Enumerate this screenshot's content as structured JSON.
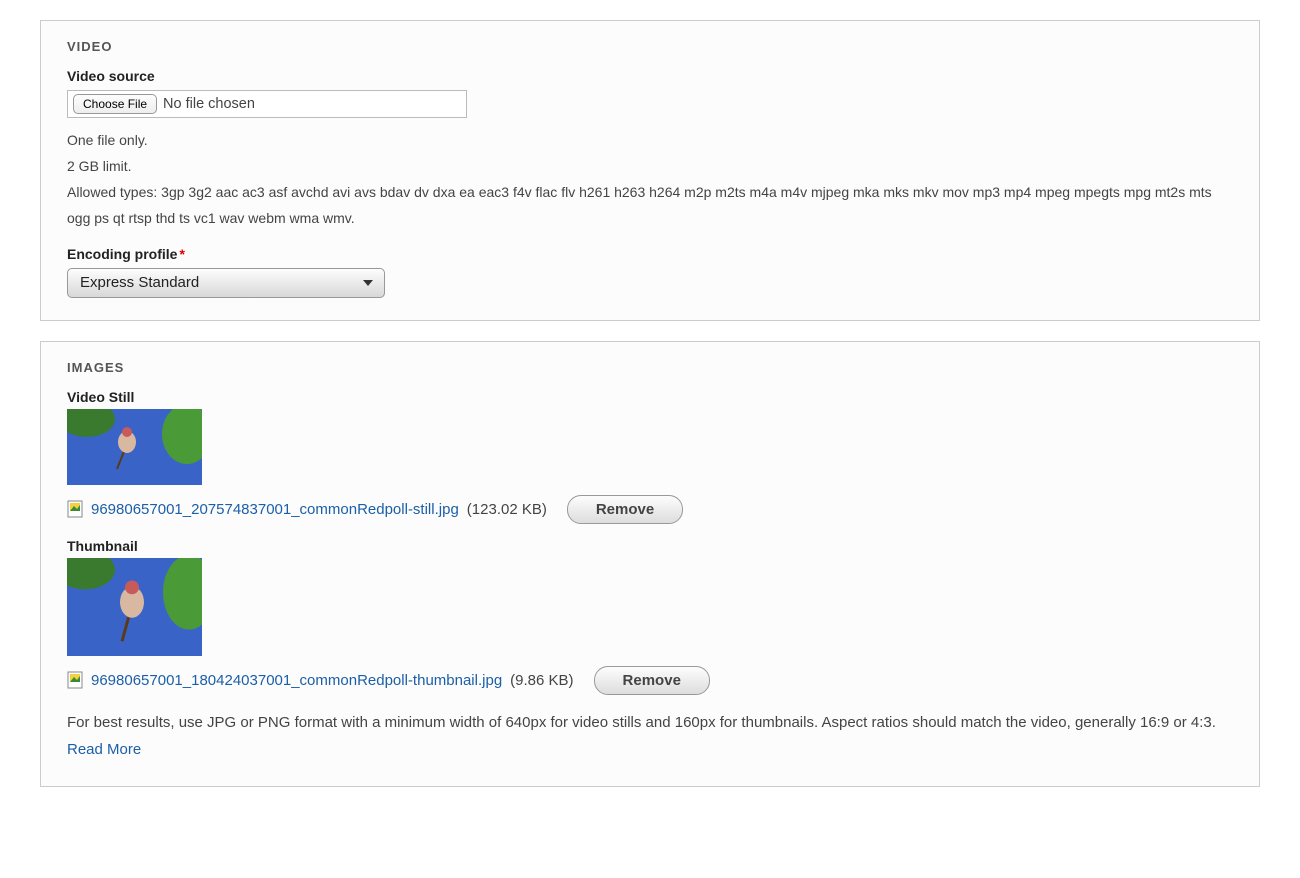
{
  "video": {
    "panel_title": "VIDEO",
    "source_label": "Video source",
    "choose_file_label": "Choose File",
    "no_file_text": "No file chosen",
    "hint_line1": "One file only.",
    "hint_line2": "2 GB limit.",
    "hint_line3": "Allowed types: 3gp 3g2 aac ac3 asf avchd avi avs bdav dv dxa ea eac3 f4v flac flv h261 h263 h264 m2p m2ts m4a m4v mjpeg mka mks mkv mov mp3 mp4 mpeg mpegts mpg mt2s mts ogg ps qt rtsp thd ts vc1 wav webm wma wmv.",
    "encoding_label": "Encoding profile",
    "encoding_value": "Express Standard"
  },
  "images": {
    "panel_title": "IMAGES",
    "still": {
      "label": "Video Still",
      "filename": "96980657001_207574837001_commonRedpoll-still.jpg",
      "size": "(123.02 KB)",
      "remove_label": "Remove"
    },
    "thumbnail": {
      "label": "Thumbnail",
      "filename": "96980657001_180424037001_commonRedpoll-thumbnail.jpg",
      "size": "(9.86 KB)",
      "remove_label": "Remove"
    },
    "help_text": "For best results, use JPG or PNG format with a minimum width of 640px for video stills and 160px for thumbnails. Aspect ratios should match the video, generally 16:9 or 4:3. ",
    "read_more_label": "Read More"
  }
}
